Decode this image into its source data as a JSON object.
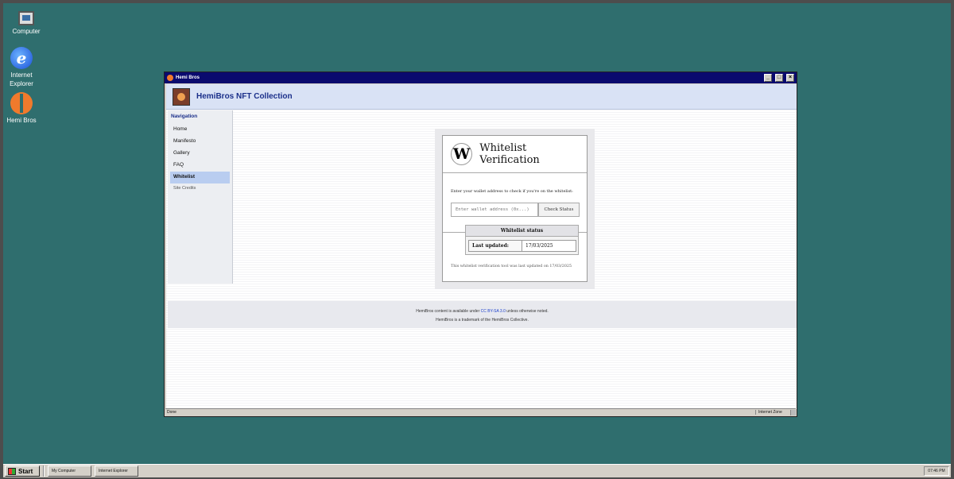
{
  "desktop": {
    "icons": [
      {
        "label": "Computer",
        "icon": "computer-icon"
      },
      {
        "label": "Internet Explorer",
        "icon": "internet-explorer-icon"
      },
      {
        "label": "Hemi Bros",
        "icon": "hemi-bros-icon"
      }
    ]
  },
  "window": {
    "title": "Hemi Bros",
    "controls": {
      "minimize": "_",
      "maximize": "□",
      "close": "×"
    },
    "status_left": "Done",
    "status_zone": "Internet Zone"
  },
  "site": {
    "title": "HemiBros NFT Collection",
    "nav_title": "Navigation",
    "nav_items": [
      "Home",
      "Manifesto",
      "Gallery",
      "FAQ",
      "Whitelist",
      "Site Credits"
    ],
    "active_nav": "Whitelist"
  },
  "card": {
    "logo": "W",
    "title": "Whitelist Verification",
    "prompt": "Enter your wallet address to check if you're on the whitelist:",
    "input_placeholder": "Enter wallet address (0x...)",
    "button_label": "Check Status",
    "status_title": "Whitelist status",
    "last_updated_label": "Last updated:",
    "last_updated_value": "17/03/2025",
    "note": "This whitelist verification tool was last updated on 17/03/2025"
  },
  "footer": {
    "line1_pre": "HemiBros content is available under ",
    "line1_link": "CC BY-SA 3.0",
    "line1_post": " unless otherwise noted.",
    "line2": "HemiBros is a trademark of the HemiBros Collective."
  },
  "taskbar": {
    "start_label": "Start",
    "tasks": [
      "My Computer",
      "Internet Explorer"
    ],
    "clock": "07:46 PM"
  }
}
